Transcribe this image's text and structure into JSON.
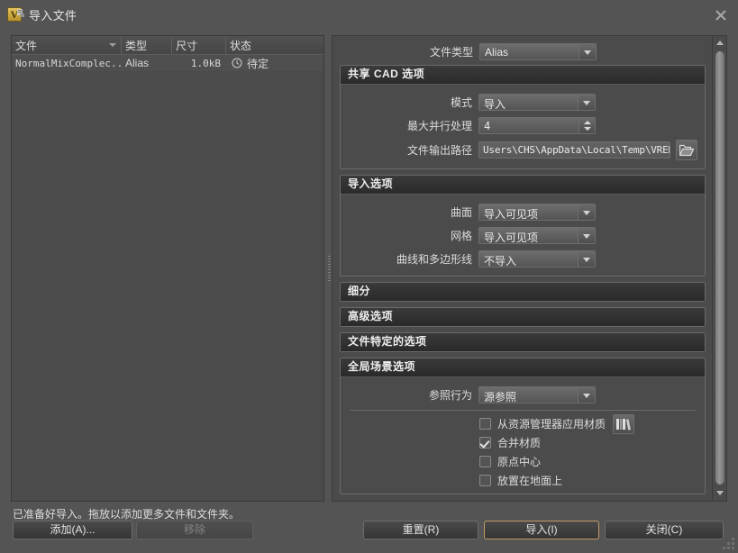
{
  "window": {
    "title": "导入文件",
    "logo_letter": "V",
    "close_label": "×"
  },
  "file_list": {
    "columns": [
      "文件",
      "类型",
      "尺寸",
      "状态"
    ],
    "rows": [
      {
        "name": "NormalMixComplec...",
        "type": "Alias",
        "size": "1.0kB",
        "state": "待定",
        "state_icon": "clock-icon"
      }
    ]
  },
  "options": {
    "file_type": {
      "label": "文件类型",
      "value": "Alias"
    },
    "shared_cad": {
      "title": "共享 CAD 选项",
      "mode": {
        "label": "模式",
        "value": "导入"
      },
      "max_parallel": {
        "label": "最大并行处理",
        "value": "4"
      },
      "output_path": {
        "label": "文件输出路径",
        "value": "Users\\CHS\\AppData\\Local\\Temp\\VREDPro",
        "browse_icon": "folder-open-icon"
      }
    },
    "import_options": {
      "title": "导入选项",
      "surface": {
        "label": "曲面",
        "value": "导入可见项"
      },
      "mesh": {
        "label": "网格",
        "value": "导入可见项"
      },
      "curves": {
        "label": "曲线和多边形线",
        "value": "不导入"
      }
    },
    "subdivision": {
      "title": "细分"
    },
    "advanced": {
      "title": "高级选项"
    },
    "file_specific": {
      "title": "文件特定的选项"
    },
    "global_scene": {
      "title": "全局场景选项",
      "reference_behavior": {
        "label": "参照行为",
        "value": "源参照"
      },
      "checkboxes": [
        {
          "label": "从资源管理器应用材质",
          "checked": false,
          "icon": "library-books-icon"
        },
        {
          "label": "合并材质",
          "checked": true
        },
        {
          "label": "原点中心",
          "checked": false
        },
        {
          "label": "放置在地面上",
          "checked": false
        }
      ]
    }
  },
  "footer": {
    "status": "已准备好导入。拖放以添加更多文件和文件夹。",
    "add_button": "添加(A)...",
    "remove_button": "移除",
    "reset_button": "重置(R)",
    "import_button": "导入(I)",
    "close_button": "关闭(C)"
  },
  "colors": {
    "accent": "#c49a62",
    "window_bg": "#545454",
    "panel_bg": "#4b4b4b",
    "group_header": "#2f2f2f"
  }
}
